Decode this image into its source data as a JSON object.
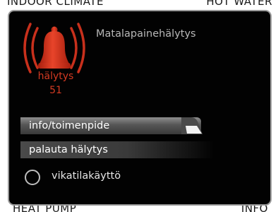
{
  "background": {
    "top_left": "INDOOR CLIMATE",
    "top_right": "HOT WATER",
    "bottom_left": "HEAT PUMP",
    "bottom_right": "INFO"
  },
  "dialog": {
    "title": "Matalapainehälytys",
    "alarm_label": "hälytys",
    "alarm_code": "51",
    "alarm_icon": "bell-alarm-icon",
    "menu_items": [
      {
        "label": "info/toimenpide",
        "selected": true
      },
      {
        "label": "palauta hälytys",
        "selected": false
      }
    ],
    "radio": {
      "label": "vikatilakäyttö",
      "checked": false
    }
  },
  "colors": {
    "alarm_red": "#d33a22",
    "dialog_bg": "#020202",
    "title_gray": "#b8b8b8"
  }
}
